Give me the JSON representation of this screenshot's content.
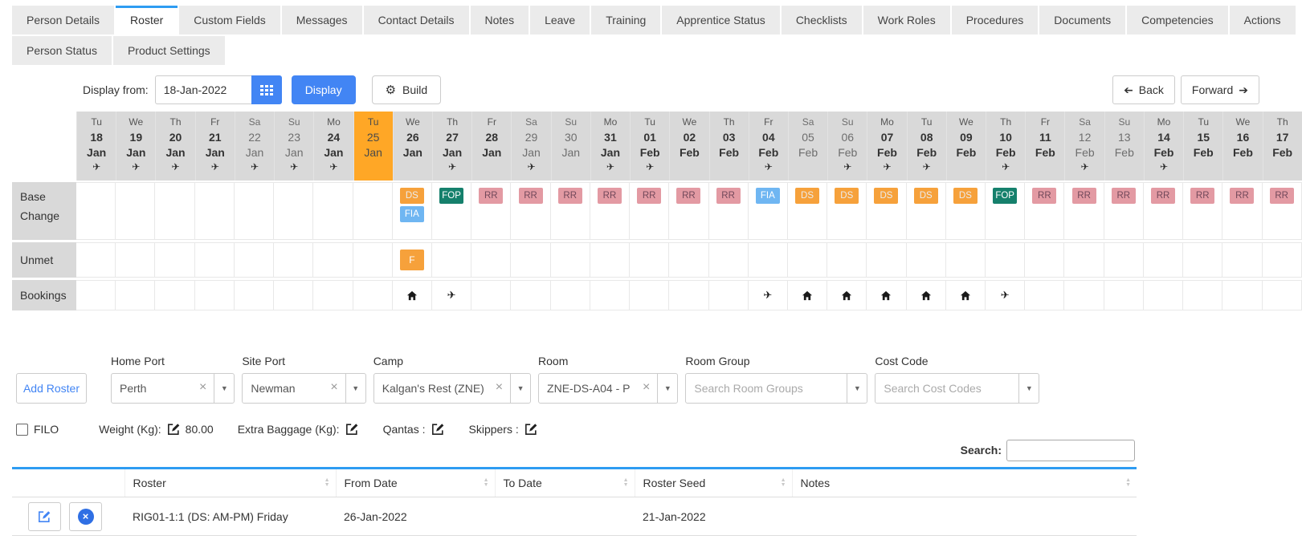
{
  "tabs": {
    "primary": [
      "Person Details",
      "Roster",
      "Custom Fields",
      "Messages",
      "Contact Details",
      "Notes",
      "Leave",
      "Training",
      "Apprentice Status",
      "Checklists",
      "Work Roles",
      "Procedures",
      "Documents",
      "Competencies",
      "Actions"
    ],
    "active": "Roster",
    "secondary": [
      "Person Status",
      "Product Settings"
    ]
  },
  "toolbar": {
    "display_from_label": "Display from:",
    "date_value": "18-Jan-2022",
    "display_label": "Display",
    "build_label": "Build",
    "back_label": "Back",
    "forward_label": "Forward"
  },
  "icons": {
    "plane": "✈",
    "gear": "⚙",
    "arrow": "➔",
    "caret": "▼",
    "clear": "×",
    "sort_up": "▲",
    "sort_down": "▼"
  },
  "calendar": {
    "row_labels": [
      "Base Change",
      "Unmet",
      "Bookings"
    ],
    "highlight_color": "#FFA726",
    "badge_colors": {
      "DS": {
        "bg": "#F6A13B",
        "fg": "#ECECEC"
      },
      "FIA": {
        "bg": "#6FB6F2",
        "fg": "#FFFFFF"
      },
      "FOP": {
        "bg": "#15806C",
        "fg": "#FFFFFF"
      },
      "RR": {
        "bg": "#E39AA3",
        "fg": "#71485A"
      },
      "F": {
        "bg": "#F6A13B",
        "fg": "#FFFFFF"
      }
    },
    "columns": [
      {
        "dow": "Tu",
        "day": "18",
        "mon": "Jan",
        "plane": true
      },
      {
        "dow": "We",
        "day": "19",
        "mon": "Jan",
        "plane": true
      },
      {
        "dow": "Th",
        "day": "20",
        "mon": "Jan",
        "plane": true
      },
      {
        "dow": "Fr",
        "day": "21",
        "mon": "Jan",
        "plane": true
      },
      {
        "dow": "Sa",
        "day": "22",
        "mon": "Jan",
        "plane": true,
        "dim": true
      },
      {
        "dow": "Su",
        "day": "23",
        "mon": "Jan",
        "plane": true,
        "dim": true
      },
      {
        "dow": "Mo",
        "day": "24",
        "mon": "Jan",
        "plane": true
      },
      {
        "dow": "Tu",
        "day": "25",
        "mon": "Jan",
        "dim": true,
        "highlight": true
      },
      {
        "dow": "We",
        "day": "26",
        "mon": "Jan",
        "base": [
          "DS",
          "FIA"
        ],
        "unmet": "F",
        "booking": "home"
      },
      {
        "dow": "Th",
        "day": "27",
        "mon": "Jan",
        "plane": true,
        "base": [
          "FOP"
        ],
        "booking": "plane"
      },
      {
        "dow": "Fr",
        "day": "28",
        "mon": "Jan",
        "base": [
          "RR"
        ]
      },
      {
        "dow": "Sa",
        "day": "29",
        "mon": "Jan",
        "plane": true,
        "dim": true,
        "base": [
          "RR"
        ]
      },
      {
        "dow": "Su",
        "day": "30",
        "mon": "Jan",
        "dim": true,
        "base": [
          "RR"
        ]
      },
      {
        "dow": "Mo",
        "day": "31",
        "mon": "Jan",
        "plane": true,
        "base": [
          "RR"
        ]
      },
      {
        "dow": "Tu",
        "day": "01",
        "mon": "Feb",
        "plane": true,
        "base": [
          "RR"
        ]
      },
      {
        "dow": "We",
        "day": "02",
        "mon": "Feb",
        "base": [
          "RR"
        ]
      },
      {
        "dow": "Th",
        "day": "03",
        "mon": "Feb",
        "base": [
          "RR"
        ]
      },
      {
        "dow": "Fr",
        "day": "04",
        "mon": "Feb",
        "plane": true,
        "base": [
          "FIA"
        ],
        "booking": "plane"
      },
      {
        "dow": "Sa",
        "day": "05",
        "mon": "Feb",
        "dim": true,
        "base": [
          "DS"
        ],
        "booking": "home"
      },
      {
        "dow": "Su",
        "day": "06",
        "mon": "Feb",
        "plane": true,
        "dim": true,
        "base": [
          "DS"
        ],
        "booking": "home"
      },
      {
        "dow": "Mo",
        "day": "07",
        "mon": "Feb",
        "plane": true,
        "base": [
          "DS"
        ],
        "booking": "home"
      },
      {
        "dow": "Tu",
        "day": "08",
        "mon": "Feb",
        "plane": true,
        "base": [
          "DS"
        ],
        "booking": "home"
      },
      {
        "dow": "We",
        "day": "09",
        "mon": "Feb",
        "base": [
          "DS"
        ],
        "booking": "home"
      },
      {
        "dow": "Th",
        "day": "10",
        "mon": "Feb",
        "plane": true,
        "base": [
          "FOP"
        ],
        "booking": "plane"
      },
      {
        "dow": "Fr",
        "day": "11",
        "mon": "Feb",
        "base": [
          "RR"
        ]
      },
      {
        "dow": "Sa",
        "day": "12",
        "mon": "Feb",
        "plane": true,
        "dim": true,
        "base": [
          "RR"
        ]
      },
      {
        "dow": "Su",
        "day": "13",
        "mon": "Feb",
        "dim": true,
        "base": [
          "RR"
        ]
      },
      {
        "dow": "Mo",
        "day": "14",
        "mon": "Feb",
        "plane": true,
        "base": [
          "RR"
        ]
      },
      {
        "dow": "Tu",
        "day": "15",
        "mon": "Feb",
        "base": [
          "RR"
        ]
      },
      {
        "dow": "We",
        "day": "16",
        "mon": "Feb",
        "base": [
          "RR"
        ]
      },
      {
        "dow": "Th",
        "day": "17",
        "mon": "Feb",
        "base": [
          "RR"
        ]
      }
    ]
  },
  "form": {
    "add_roster_label": "Add Roster",
    "fields": [
      {
        "label": "Home Port",
        "value": "Perth"
      },
      {
        "label": "Site Port",
        "value": "Newman"
      },
      {
        "label": "Camp",
        "value": "Kalgan's Rest (ZNE)"
      },
      {
        "label": "Room",
        "value": "ZNE-DS-A04 - P"
      },
      {
        "label": "Room Group",
        "placeholder": "Search Room Groups"
      },
      {
        "label": "Cost Code",
        "placeholder": "Search Cost Codes"
      }
    ]
  },
  "filo": {
    "label": "FILO",
    "checked": false,
    "items": [
      {
        "label": "Weight (Kg):",
        "value": "80.00"
      },
      {
        "label": "Extra Baggage (Kg):",
        "value": ""
      },
      {
        "label": "Qantas :",
        "value": ""
      },
      {
        "label": "Skippers :",
        "value": ""
      }
    ]
  },
  "search": {
    "label": "Search:",
    "value": ""
  },
  "table": {
    "headers": [
      "",
      "Roster",
      "From Date",
      "To Date",
      "Roster Seed",
      "Notes"
    ],
    "rows": [
      {
        "roster": "RIG01-1:1 (DS: AM-PM) Friday",
        "from_date": "26-Jan-2022",
        "to_date": "",
        "roster_seed": "21-Jan-2022",
        "notes": ""
      }
    ]
  }
}
